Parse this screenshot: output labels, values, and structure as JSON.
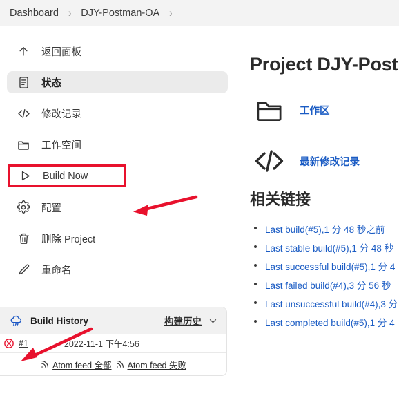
{
  "breadcrumb": {
    "items": [
      {
        "label": "Dashboard"
      },
      {
        "label": "DJY-Postman-OA"
      }
    ],
    "separator": "›"
  },
  "sidebar": {
    "items": [
      {
        "label": "返回面板",
        "icon": "up-arrow-icon",
        "selected": false,
        "annotated": false
      },
      {
        "label": "状态",
        "icon": "document-icon",
        "selected": true,
        "annotated": false
      },
      {
        "label": "修改记录",
        "icon": "code-icon",
        "selected": false,
        "annotated": false
      },
      {
        "label": "工作空间",
        "icon": "folder-icon",
        "selected": false,
        "annotated": false
      },
      {
        "label": "Build Now",
        "icon": "play-icon",
        "selected": false,
        "annotated": true
      },
      {
        "label": "配置",
        "icon": "gear-icon",
        "selected": false,
        "annotated": false
      },
      {
        "label": "删除 Project",
        "icon": "trash-icon",
        "selected": false,
        "annotated": false
      },
      {
        "label": "重命名",
        "icon": "pencil-icon",
        "selected": false,
        "annotated": false
      }
    ]
  },
  "build_history": {
    "title": "Build History",
    "weather_icon": "rain-cloud-icon",
    "link_label": "构建历史",
    "chevron_icon": "chevron-down-icon",
    "rows": [
      {
        "status_icon": "failed-red-x-icon",
        "build_number": "#1",
        "timestamp": "2022-11-1 下午4:56"
      }
    ],
    "feeds": [
      {
        "icon": "rss-icon",
        "label": "Atom feed 全部"
      },
      {
        "icon": "rss-icon",
        "label": "Atom feed 失败"
      }
    ]
  },
  "main": {
    "project_title": "Project DJY-Postm",
    "big_links": [
      {
        "icon": "folder-icon",
        "label": "工作区"
      },
      {
        "icon": "code-icon",
        "label": "最新修改记录"
      }
    ],
    "related_heading": "相关链接",
    "related_links": [
      {
        "label": "Last build(#5),1 分 48 秒之前"
      },
      {
        "label": "Last stable build(#5),1 分 48 秒"
      },
      {
        "label": "Last successful build(#5),1 分 4"
      },
      {
        "label": "Last failed build(#4),3 分 56 秒"
      },
      {
        "label": "Last unsuccessful build(#4),3 分"
      },
      {
        "label": "Last completed build(#5),1 分 4"
      }
    ]
  },
  "annotations": {
    "accent_color": "#e8112d",
    "arrows": [
      {
        "name": "arrow-to-build-now",
        "points_to": "Build Now"
      },
      {
        "name": "arrow-to-build-1",
        "points_to": "#1"
      }
    ],
    "boxes": [
      {
        "name": "box-around-build-now",
        "target": "Build Now"
      }
    ]
  }
}
